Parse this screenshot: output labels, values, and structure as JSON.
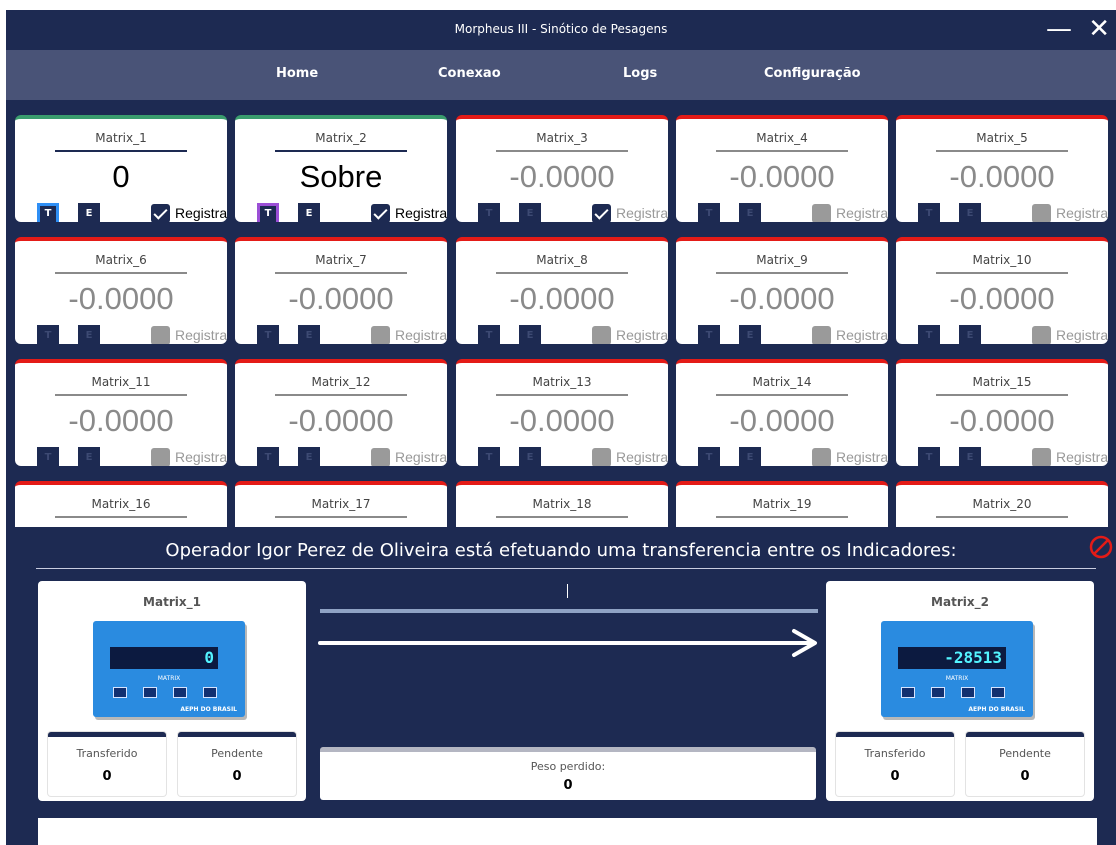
{
  "window": {
    "title": "Morpheus III - Sinótico de Pesagens",
    "minimize_label": "—",
    "close_label": "✕"
  },
  "nav": {
    "items": [
      "Home",
      "Conexao",
      "Logs",
      "Configuração"
    ]
  },
  "cards": [
    {
      "name": "Matrix_1",
      "value": "0",
      "status": "ok",
      "registrar": true,
      "selected": "blue"
    },
    {
      "name": "Matrix_2",
      "value": "Sobre",
      "status": "ok",
      "registrar": true,
      "selected": "purple"
    },
    {
      "name": "Matrix_3",
      "value": "-0.0000",
      "status": "error",
      "registrar": true
    },
    {
      "name": "Matrix_4",
      "value": "-0.0000",
      "status": "error",
      "registrar": false
    },
    {
      "name": "Matrix_5",
      "value": "-0.0000",
      "status": "error",
      "registrar": false
    },
    {
      "name": "Matrix_6",
      "value": "-0.0000",
      "status": "error",
      "registrar": false
    },
    {
      "name": "Matrix_7",
      "value": "-0.0000",
      "status": "error",
      "registrar": false
    },
    {
      "name": "Matrix_8",
      "value": "-0.0000",
      "status": "error",
      "registrar": false
    },
    {
      "name": "Matrix_9",
      "value": "-0.0000",
      "status": "error",
      "registrar": false
    },
    {
      "name": "Matrix_10",
      "value": "-0.0000",
      "status": "error",
      "registrar": false
    },
    {
      "name": "Matrix_11",
      "value": "-0.0000",
      "status": "error",
      "registrar": false
    },
    {
      "name": "Matrix_12",
      "value": "-0.0000",
      "status": "error",
      "registrar": false
    },
    {
      "name": "Matrix_13",
      "value": "-0.0000",
      "status": "error",
      "registrar": false
    },
    {
      "name": "Matrix_14",
      "value": "-0.0000",
      "status": "error",
      "registrar": false
    },
    {
      "name": "Matrix_15",
      "value": "-0.0000",
      "status": "error",
      "registrar": false
    },
    {
      "name": "Matrix_16",
      "value": "",
      "status": "error",
      "registrar": false
    },
    {
      "name": "Matrix_17",
      "value": "",
      "status": "error",
      "registrar": false
    },
    {
      "name": "Matrix_18",
      "value": "",
      "status": "error",
      "registrar": false
    },
    {
      "name": "Matrix_19",
      "value": "",
      "status": "error",
      "registrar": false
    },
    {
      "name": "Matrix_20",
      "value": "",
      "status": "error",
      "registrar": false
    }
  ],
  "card_buttons": {
    "tare": "T",
    "e": "E",
    "registrar": "Registrar"
  },
  "transfer": {
    "message": "Operador Igor Perez de Oliveira está efetuando uma transferencia entre os Indicadores:",
    "source": {
      "name": "Matrix_1",
      "display": "0",
      "model": "MATRIX",
      "brand": "AEPH DO BRASIL",
      "transferido_label": "Transferido",
      "transferido": "0",
      "pendente_label": "Pendente",
      "pendente": "0"
    },
    "target": {
      "name": "Matrix_2",
      "display": "-28513",
      "model": "MATRIX",
      "brand": "AEPH DO BRASIL",
      "transferido_label": "Transferido",
      "transferido": "0",
      "pendente_label": "Pendente",
      "pendente": "0"
    },
    "peso_perdido_label": "Peso perdido:",
    "peso_perdido": "0"
  },
  "colors": {
    "navy": "#1d2a52",
    "nav_bar": "#495377",
    "ok": "#3a9d6e",
    "error": "#e41b17",
    "cancel": "#e41b17"
  }
}
